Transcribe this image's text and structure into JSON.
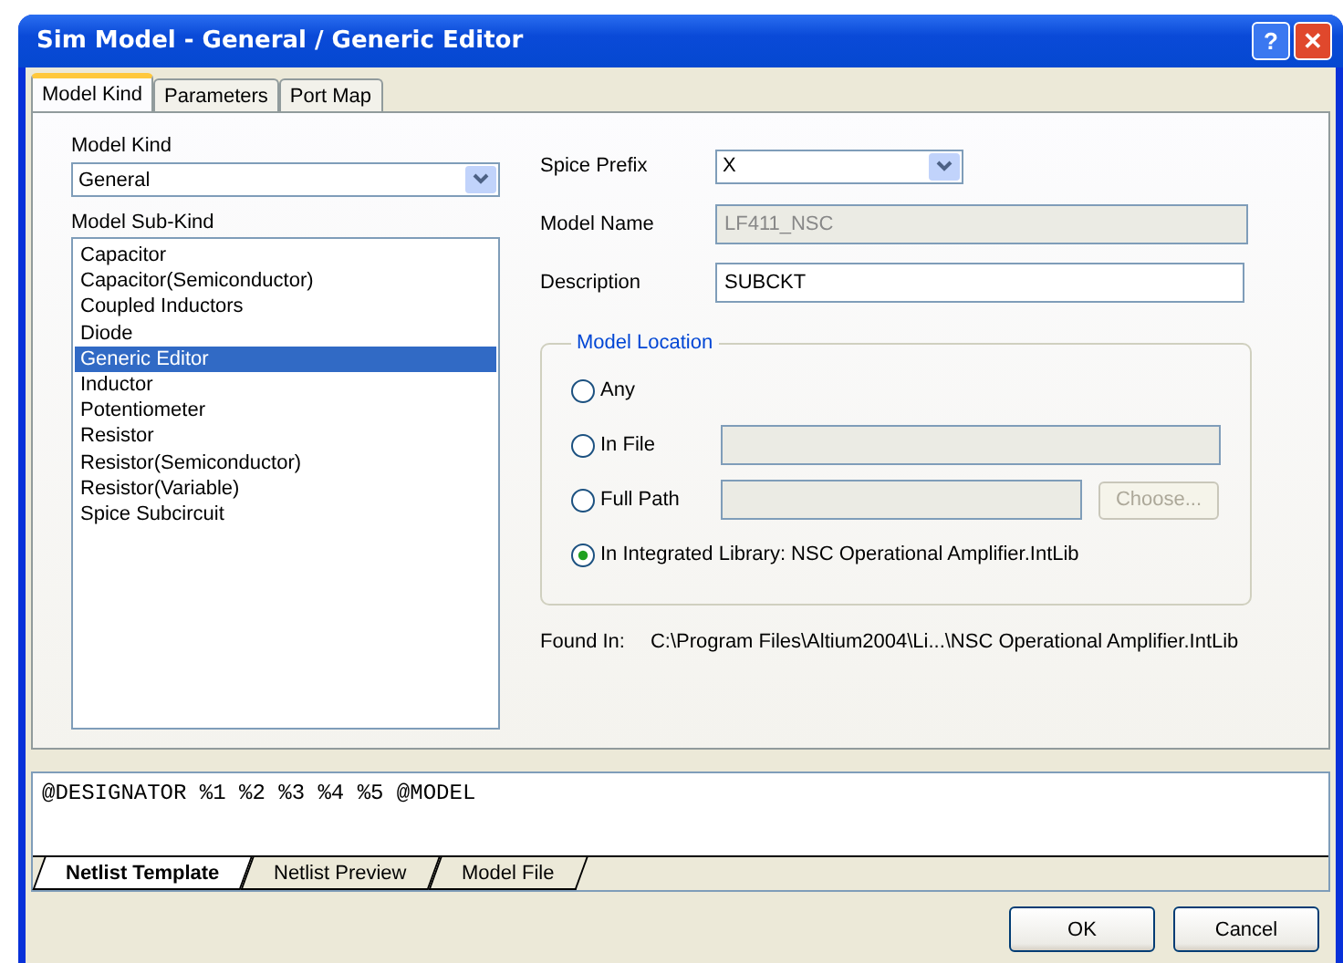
{
  "window": {
    "title": "Sim Model - General / Generic Editor"
  },
  "title_buttons": [
    {
      "kind": "help",
      "label": "?"
    },
    {
      "kind": "close",
      "label": "✕"
    }
  ],
  "tabs": [
    {
      "label": "Model Kind",
      "selected": true
    },
    {
      "label": "Parameters",
      "selected": false
    },
    {
      "label": "Port Map",
      "selected": false
    }
  ],
  "model_kind": {
    "label": "Model Kind",
    "value": "General"
  },
  "model_sub_kind": {
    "label": "Model Sub-Kind",
    "items": [
      {
        "label": "Capacitor",
        "selected": false
      },
      {
        "label": "Capacitor(Semiconductor)",
        "selected": false
      },
      {
        "label": "Coupled Inductors",
        "selected": false
      },
      {
        "label": "Diode",
        "selected": false
      },
      {
        "label": "Generic Editor",
        "selected": true
      },
      {
        "label": "Inductor",
        "selected": false
      },
      {
        "label": "Potentiometer",
        "selected": false
      },
      {
        "label": "Resistor",
        "selected": false
      },
      {
        "label": "Resistor(Semiconductor)",
        "selected": false
      },
      {
        "label": "Resistor(Variable)",
        "selected": false
      },
      {
        "label": "Spice Subcircuit",
        "selected": false
      }
    ]
  },
  "spice_prefix": {
    "label": "Spice Prefix",
    "value": "X"
  },
  "model_name": {
    "label": "Model Name",
    "value": "LF411_NSC",
    "disabled": true
  },
  "description": {
    "label": "Description",
    "value": "SUBCKT",
    "disabled": false
  },
  "model_location": {
    "title": "Model Location",
    "options": [
      {
        "kind": "plain",
        "label": "Any",
        "selected": false
      },
      {
        "kind": "field",
        "label": "In File",
        "selected": false,
        "field_disabled": true
      },
      {
        "kind": "field_button",
        "label": "Full Path",
        "selected": false,
        "field_disabled": true,
        "button": "Choose...",
        "button_disabled": true
      },
      {
        "kind": "plain",
        "label": "In Integrated Library: NSC Operational Amplifier.IntLib",
        "selected": true
      }
    ]
  },
  "found_in": {
    "label": "Found In:",
    "value": "C:\\Program Files\\Altium2004\\Li...\\NSC Operational Amplifier.IntLib"
  },
  "netlist_text": "@DESIGNATOR %1 %2 %3 %4 %5 @MODEL",
  "bottom_tabs": [
    {
      "label": "Netlist Template",
      "selected": true
    },
    {
      "label": "Netlist Preview",
      "selected": false
    },
    {
      "label": "Model File",
      "selected": false
    }
  ],
  "buttons": [
    {
      "label": "OK"
    },
    {
      "label": "Cancel"
    }
  ]
}
